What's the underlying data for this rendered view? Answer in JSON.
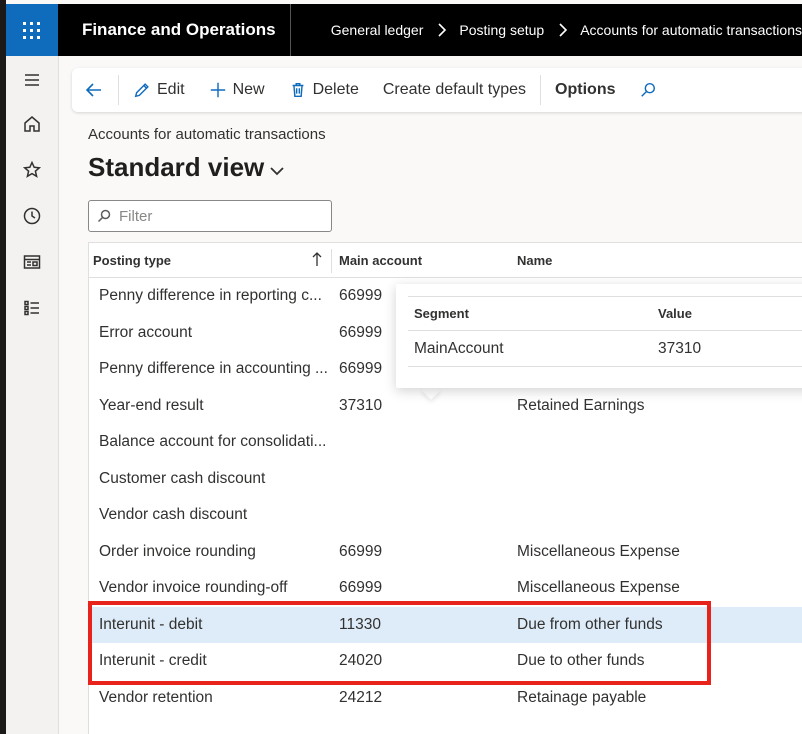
{
  "app": {
    "title": "Finance and Operations"
  },
  "breadcrumb": [
    "General ledger",
    "Posting setup",
    "Accounts for automatic transactions"
  ],
  "toolbar": {
    "edit_label": "Edit",
    "new_label": "New",
    "delete_label": "Delete",
    "create_default_types_label": "Create default types",
    "options_label": "Options"
  },
  "page": {
    "caption": "Accounts for automatic transactions",
    "view_name": "Standard view"
  },
  "filter": {
    "placeholder": "Filter",
    "value": ""
  },
  "grid": {
    "columns": [
      "Posting type",
      "Main account",
      "Name"
    ],
    "rows": [
      {
        "posting_type": "Penny difference in reporting c...",
        "main_account": "66999",
        "name": ""
      },
      {
        "posting_type": "Error account",
        "main_account": "66999",
        "name": ""
      },
      {
        "posting_type": "Penny difference in accounting ...",
        "main_account": "66999",
        "name": ""
      },
      {
        "posting_type": "Year-end result",
        "main_account": "37310",
        "name": "Retained Earnings"
      },
      {
        "posting_type": "Balance account for consolidati...",
        "main_account": "",
        "name": ""
      },
      {
        "posting_type": "Customer cash discount",
        "main_account": "",
        "name": ""
      },
      {
        "posting_type": "Vendor cash discount",
        "main_account": "",
        "name": ""
      },
      {
        "posting_type": "Order invoice rounding",
        "main_account": "66999",
        "name": "Miscellaneous Expense"
      },
      {
        "posting_type": "Vendor invoice rounding-off",
        "main_account": "66999",
        "name": "Miscellaneous Expense"
      },
      {
        "posting_type": "Interunit - debit",
        "main_account": "11330",
        "name": "Due from other funds"
      },
      {
        "posting_type": "Interunit - credit",
        "main_account": "24020",
        "name": "Due to other funds"
      },
      {
        "posting_type": "Vendor retention",
        "main_account": "24212",
        "name": "Retainage payable"
      }
    ],
    "selected_row": 9
  },
  "popup": {
    "columns": [
      "Segment",
      "Value"
    ],
    "rows": [
      {
        "segment": "MainAccount",
        "value": "37310"
      }
    ]
  },
  "colors": {
    "brand": "#0f6cbd",
    "selected_row": "#deecf9",
    "highlight_border": "#e8231c"
  }
}
